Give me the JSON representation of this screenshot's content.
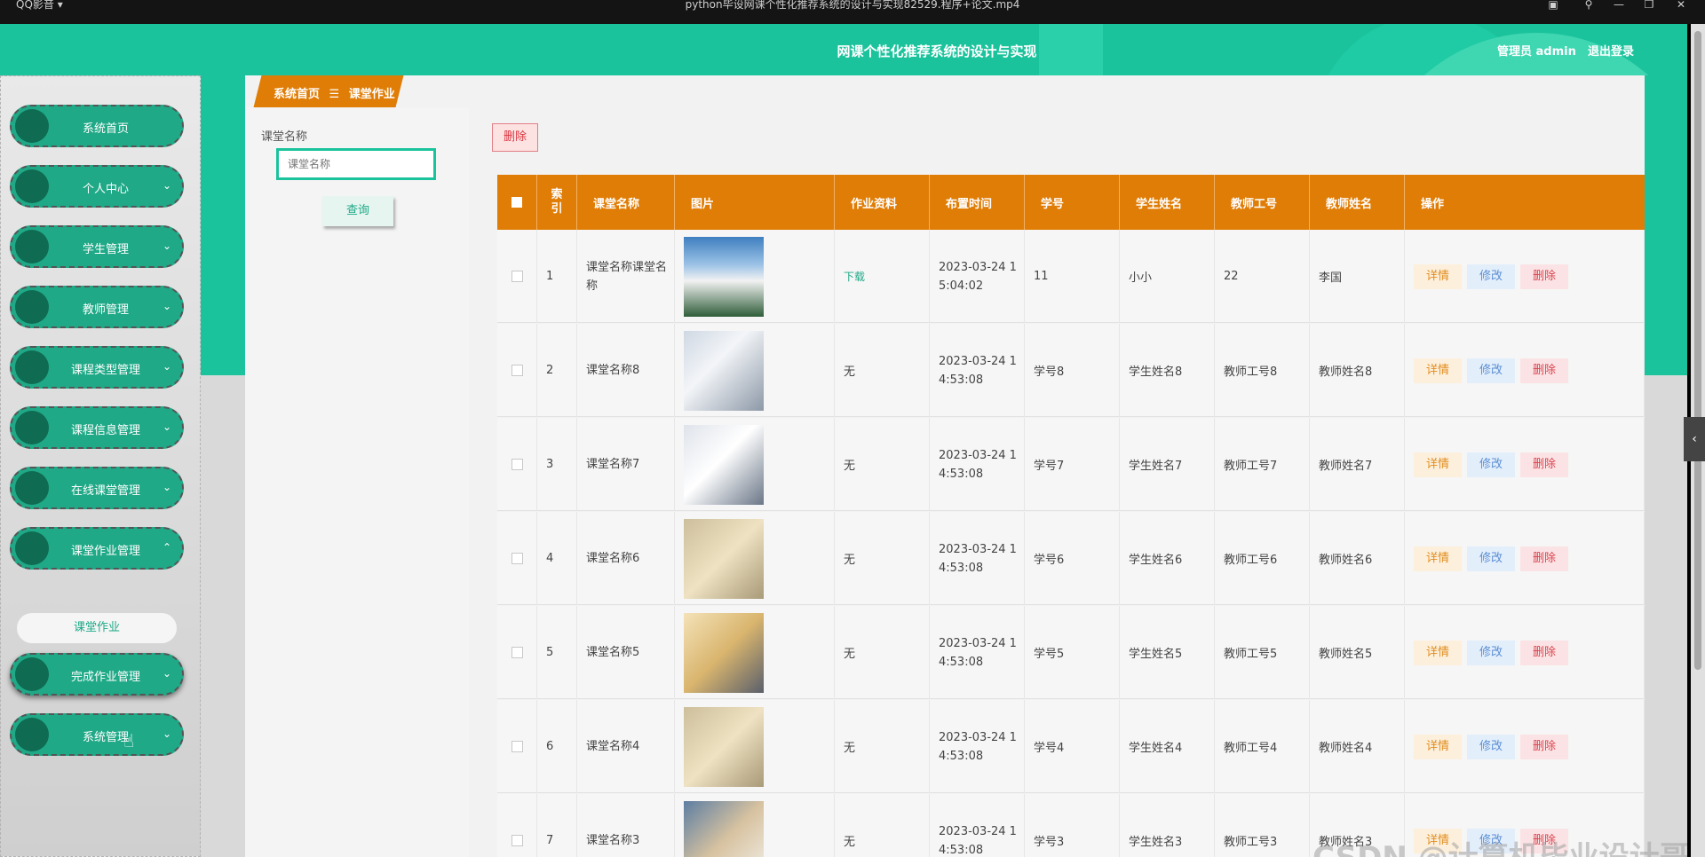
{
  "player": {
    "app_name": "QQ影音 ▾",
    "file_name": "python毕设网课个性化推荐系统的设计与实现82529.程序+论文.mp4"
  },
  "header": {
    "title": "网课个性化推荐系统的设计与实现",
    "user": "管理员 admin",
    "logout": "退出登录"
  },
  "sidebar": {
    "items": [
      {
        "label": "系统首页",
        "chevron": ""
      },
      {
        "label": "个人中心",
        "chevron": "⌄"
      },
      {
        "label": "学生管理",
        "chevron": "⌄"
      },
      {
        "label": "教师管理",
        "chevron": "⌄"
      },
      {
        "label": "课程类型管理",
        "chevron": "⌄"
      },
      {
        "label": "课程信息管理",
        "chevron": "⌄"
      },
      {
        "label": "在线课堂管理",
        "chevron": "⌄"
      },
      {
        "label": "课堂作业管理",
        "chevron": "⌃"
      },
      {
        "label": "完成作业管理",
        "chevron": "⌄"
      },
      {
        "label": "系统管理",
        "chevron": "⌄"
      }
    ],
    "submenu": "课堂作业"
  },
  "breadcrumb": {
    "home": "系统首页",
    "sep": "☰",
    "current": "课堂作业"
  },
  "filter": {
    "label": "课堂名称",
    "placeholder": "课堂名称",
    "query_button": "查询"
  },
  "batch_delete": "删除",
  "table": {
    "headers": [
      "索引",
      "课堂名称",
      "图片",
      "作业资料",
      "布置时间",
      "学号",
      "学生姓名",
      "教师工号",
      "教师姓名",
      "操作"
    ],
    "index_header_l1": "索",
    "index_header_l2": "引",
    "rows": [
      {
        "idx": "1",
        "name": "课堂名称课堂名称",
        "material": "下载",
        "time": "2023-03-24 15:04:02",
        "sno": "11",
        "sname": "小小",
        "tno": "22",
        "tname": "李国"
      },
      {
        "idx": "2",
        "name": "课堂名称8",
        "material": "无",
        "time": "2023-03-24 14:53:08",
        "sno": "学号8",
        "sname": "学生姓名8",
        "tno": "教师工号8",
        "tname": "教师姓名8"
      },
      {
        "idx": "3",
        "name": "课堂名称7",
        "material": "无",
        "time": "2023-03-24 14:53:08",
        "sno": "学号7",
        "sname": "学生姓名7",
        "tno": "教师工号7",
        "tname": "教师姓名7"
      },
      {
        "idx": "4",
        "name": "课堂名称6",
        "material": "无",
        "time": "2023-03-24 14:53:08",
        "sno": "学号6",
        "sname": "学生姓名6",
        "tno": "教师工号6",
        "tname": "教师姓名6"
      },
      {
        "idx": "5",
        "name": "课堂名称5",
        "material": "无",
        "time": "2023-03-24 14:53:08",
        "sno": "学号5",
        "sname": "学生姓名5",
        "tno": "教师工号5",
        "tname": "教师姓名5"
      },
      {
        "idx": "6",
        "name": "课堂名称4",
        "material": "无",
        "time": "2023-03-24 14:53:08",
        "sno": "学号4",
        "sname": "学生姓名4",
        "tno": "教师工号4",
        "tname": "教师姓名4"
      },
      {
        "idx": "7",
        "name": "课堂名称3",
        "material": "无",
        "time": "2023-03-24 14:53:08",
        "sno": "学号3",
        "sname": "学生姓名3",
        "tno": "教师工号3",
        "tname": "教师姓名3"
      }
    ],
    "ops": {
      "detail": "详情",
      "edit": "修改",
      "delete": "删除"
    }
  },
  "watermark": "CSDN @计算机毕业设计哥",
  "colors": {
    "primary": "#1bc39c",
    "header_orange": "#e07d06",
    "danger": "#d9434d"
  }
}
